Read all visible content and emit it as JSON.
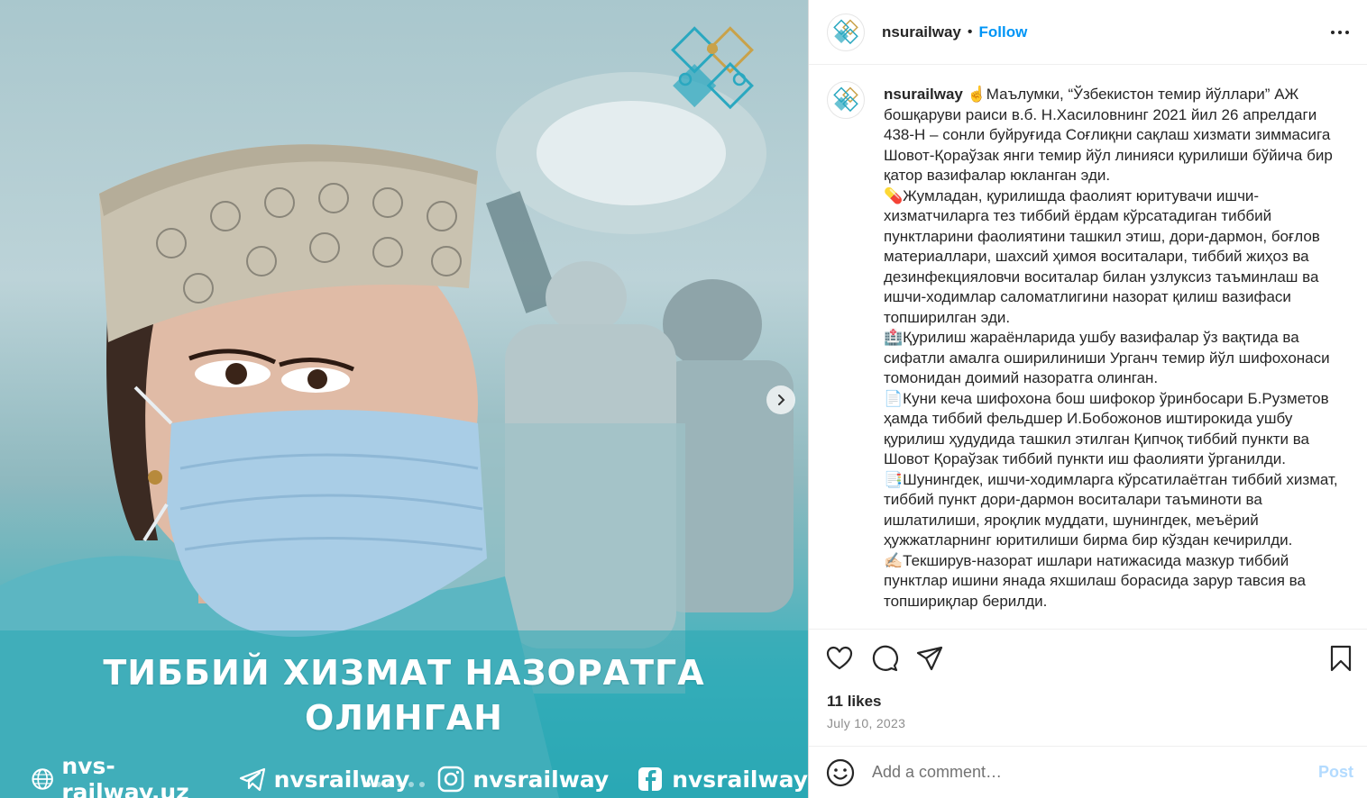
{
  "post_image": {
    "headline_line1": "ТИББИЙ ХИЗМАТ НАЗОРАТГА",
    "headline_line2": "ОЛИНГАН",
    "socials": [
      {
        "icon": "globe-icon",
        "label": "nvs-railway.uz"
      },
      {
        "icon": "telegram-icon",
        "label": "nvsrailway"
      },
      {
        "icon": "instagram-icon",
        "label": "nvsrailway"
      },
      {
        "icon": "facebook-icon",
        "label": "nvsrailway"
      }
    ],
    "carousel_total": 6,
    "carousel_active": 1
  },
  "header": {
    "username": "nsurailway",
    "separator": "•",
    "follow_label": "Follow"
  },
  "caption": {
    "username": "nsurailway",
    "text": " ☝Маълумки, “Ўзбекистон темир йўллари” АЖ бошқаруви раиси в.б. Н.Хасиловнинг 2021 йил 26 апрелдаги 438-Н – сонли буйруғида Соғлиқни сақлаш хизмати зиммасига Шовот-Қораўзак янги темир йўл линияси қурилиши бўйича бир қатор вазифалар юкланган эди.\n💊Жумладан, қурилишда фаолият юритувачи ишчи-хизматчиларга тез тиббий ёрдам кўрсатадиган тиббий пунктларини фаолиятини ташкил этиш, дори-дармон, боғлов материаллари, шахсий ҳимоя воситалари, тиббий жиҳоз ва дезинфекцияловчи воситалар билан узлуксиз таъминлаш ва ишчи-ходимлар саломатлигини назорат қилиш вазифаси топширилган эди.\n🏥Қурилиш жараёнларида ушбу вазифалар ўз вақтида ва сифатли амалга оширилиниши Урганч темир йўл шифохонаси томонидан доимий назоратга олинган.\n📄Куни кеча шифохона бош шифокор ўринбосари Б.Рузметов ҳамда тиббий фельдшер И.Бобожонов иштирокида ушбу қурилиш ҳудудида ташкил этилган Қипчоқ тиббий пункти ва Шовот Қораўзак тиббий пункти иш фаолияти ўрганилди.\n📑Шунингдек, ишчи-ходимларга кўрсатилаётган тиббий хизмат, тиббий пункт дори-дармон воситалари таъминоти ва ишлатилиши, яроқлик муддати, шунингдек, меъёрий ҳужжатларнинг юритилиши бирма бир кўздан кечирилди.\n✍🏻Текширув-назорат ишлари натижасида мазкур тиббий пунктлар ишини янада яхшилаш борасида зарур тавсия ва топшириқлар берилди."
  },
  "actions": {
    "likes": "11 likes",
    "date": "July 10, 2023"
  },
  "add_comment": {
    "placeholder": "Add a comment…",
    "post_label": "Post"
  },
  "colors": {
    "link_blue": "#0095f6",
    "post_disabled": "#b3dbff",
    "image_teal": "#2aa8b4"
  }
}
